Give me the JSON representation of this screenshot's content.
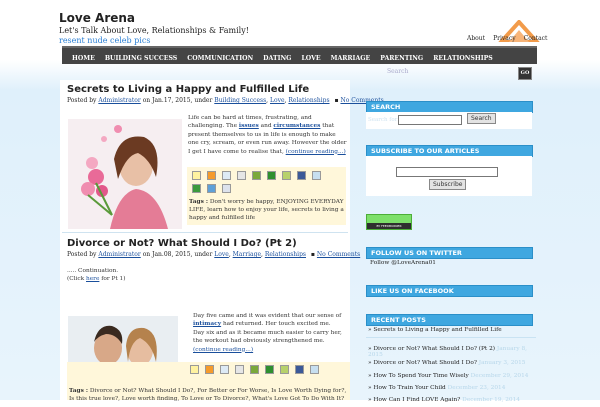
{
  "header": {
    "site_title": "Love Arena",
    "tagline": "Let's Talk About Love, Relationships & Family!",
    "promo_link": "resent nude celeb pics",
    "top_links": [
      "About",
      "Privacy",
      "Contact"
    ]
  },
  "nav": {
    "items": [
      "HOME",
      "BUILDING SUCCESS",
      "COMMUNICATION",
      "DATING",
      "LOVE",
      "MARRIAGE",
      "PARENTING",
      "RELATIONSHIPS"
    ]
  },
  "top_search": {
    "placeholder": "Search",
    "button": "GO"
  },
  "posts": [
    {
      "title": "Secrets to Living a Happy and Fulfilled Life",
      "meta_prefix": "Posted by",
      "author": "Administrator",
      "date": "on Jan.17, 2015, under",
      "categories": [
        "Building Success",
        "Love",
        "Relationships"
      ],
      "comments": "No Comments",
      "excerpt_1": "Life can be hard at times, frustrating, and challenging. The",
      "kw1": "issues",
      "and": "and",
      "kw2": "circumstances",
      "excerpt_2": "that present themselves to us in life is enough to make one cry, scream, or even run away. However the older I get I have come to realise that,",
      "more": "(continue reading...)",
      "tags_label": "Tags :",
      "tags": [
        "Don't worry be happy",
        "ENJOYING EVERYDAY LIFE",
        "learn how to enjoy your life",
        "secrets to living a happy and fulfilled life"
      ]
    },
    {
      "title": "Divorce or Not? What Should I Do? (Pt 2)",
      "meta_prefix": "Posted by",
      "author": "Administrator",
      "date": "on Jan.08, 2015, under",
      "categories": [
        "Love",
        "Marriage",
        "Relationships"
      ],
      "comments": "No Comments",
      "continuation": "..... Continuation.",
      "click": "(Click",
      "here": "here",
      "forpt": "for Pt 1)",
      "excerpt_1": "Day five came and it was evident that our sense of",
      "kw1": "intimacy",
      "excerpt_1b": "had returned. Her touch excited me.",
      "excerpt_2": "Day six and as it became much easier to carry her, the workout had obviously strengthened me.",
      "more": "(continue reading...)",
      "tags_label": "Tags :",
      "tags": [
        "Divorce or Not? What Should I Do?",
        "For Better or For Worse",
        "Is Love Worth Dying for?",
        "Is this true love?",
        "Love worth finding",
        "To Love or To Divorce?",
        "What's Love Got To Do With It?"
      ]
    }
  ],
  "sidebar": {
    "search": {
      "heading": "SEARCH",
      "label": "Search for:",
      "button": "Search"
    },
    "subscribe": {
      "heading": "SUBSCRIBE TO OUR ARTICLES",
      "button": "Subscribe"
    },
    "feedburner": "BY FEEDBURNER",
    "twitter": {
      "heading": "FOLLOW US ON TWITTER",
      "text": "Follow @LoveArena01"
    },
    "facebook": {
      "heading": "LIKE US ON FACEBOOK"
    },
    "recent": {
      "heading": "RECENT POSTS",
      "items": [
        {
          "title": "Secrets to Living a Happy and Fulfilled Life",
          "date": ""
        },
        {
          "title": "Divorce or Not? What Should I Do? (Pt 2)",
          "date": "January 8, 2015"
        },
        {
          "title": "Divorce or Not? What Should I Do?",
          "date": "January 3, 2015"
        },
        {
          "title": "How To Spend Your Time Wisely",
          "date": "December 29, 2014"
        },
        {
          "title": "How To Train Your Child",
          "date": "December 23, 2014"
        },
        {
          "title": "How Can I Find LOVE Again?",
          "date": "December 19, 2014"
        }
      ]
    }
  },
  "colors": {
    "nav_bg": "#444444",
    "sidebar_heading": "#3fa7e0",
    "link": "#1a4f9c",
    "tag_bg": "#fff7da"
  }
}
